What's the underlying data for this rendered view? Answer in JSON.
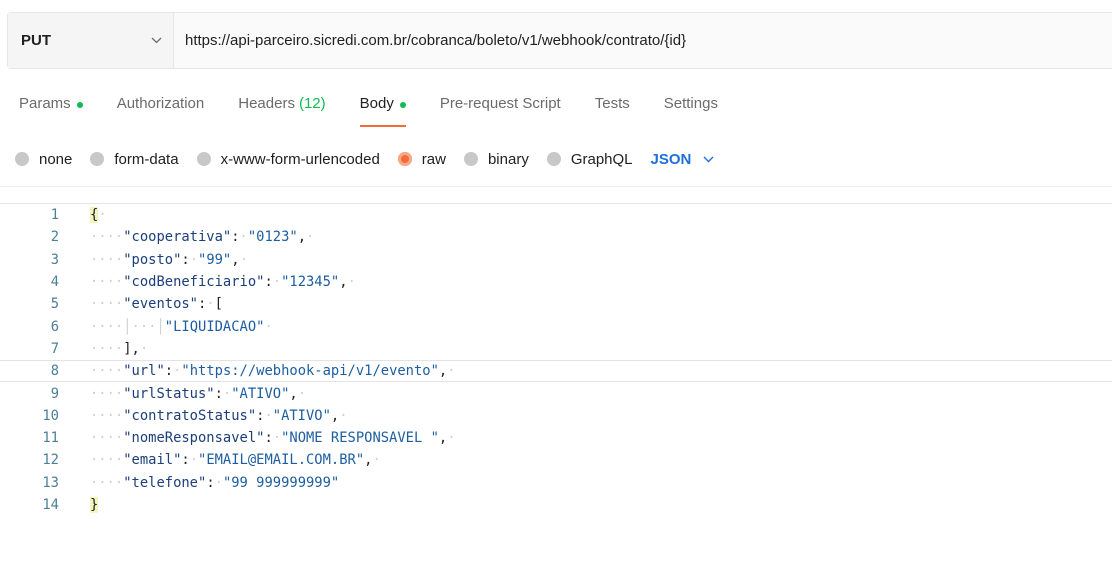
{
  "request": {
    "method": "PUT",
    "url": "https://api-parceiro.sicredi.com.br/cobranca/boleto/v1/webhook/contrato/{id}"
  },
  "tabs": [
    {
      "label": "Params",
      "dot": true,
      "count": ""
    },
    {
      "label": "Authorization",
      "dot": false,
      "count": ""
    },
    {
      "label": "Headers",
      "dot": false,
      "count": "(12)"
    },
    {
      "label": "Body",
      "dot": true,
      "count": "",
      "active": true
    },
    {
      "label": "Pre-request Script",
      "dot": false,
      "count": ""
    },
    {
      "label": "Tests",
      "dot": false,
      "count": ""
    },
    {
      "label": "Settings",
      "dot": false,
      "count": ""
    }
  ],
  "body_types": {
    "options": [
      "none",
      "form-data",
      "x-www-form-urlencoded",
      "raw",
      "binary",
      "GraphQL"
    ],
    "selected": "raw",
    "format": "JSON"
  },
  "editor": {
    "lines": [
      {
        "n": "1"
      },
      {
        "n": "2",
        "key": "\"cooperativa\"",
        "value": "\"0123\""
      },
      {
        "n": "3",
        "key": "\"posto\"",
        "value": "\"99\""
      },
      {
        "n": "4",
        "key": "\"codBeneficiario\"",
        "value": "\"12345\""
      },
      {
        "n": "5",
        "key": "\"eventos\""
      },
      {
        "n": "6",
        "value": "\"LIQUIDACAO\""
      },
      {
        "n": "7"
      },
      {
        "n": "8",
        "key": "\"url\"",
        "value": "\"https://webhook-api/v1/evento\""
      },
      {
        "n": "9",
        "key": "\"urlStatus\"",
        "value": "\"ATIVO\""
      },
      {
        "n": "10",
        "key": "\"contratoStatus\"",
        "value": "\"ATIVO\""
      },
      {
        "n": "11",
        "key": "\"nomeResponsavel\"",
        "value": "\"NOME RESPONSAVEL \""
      },
      {
        "n": "12",
        "key": "\"email\"",
        "value": "\"EMAIL@EMAIL.COM.BR\""
      },
      {
        "n": "13",
        "key": "\"telefone\"",
        "value": "\"99 999999999\""
      },
      {
        "n": "14"
      }
    ]
  },
  "colors": {
    "accent": "#f26b3a",
    "active_dot": "#0cbb52",
    "json_blue": "#1d6fdc"
  }
}
